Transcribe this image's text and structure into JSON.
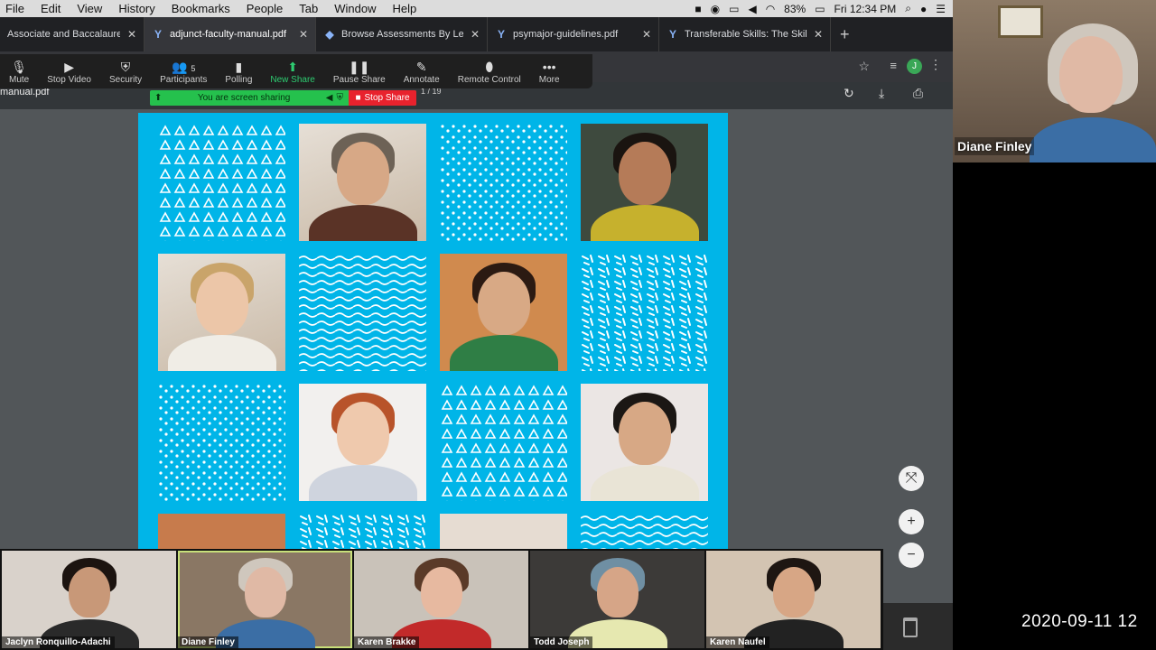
{
  "menubar": {
    "items": [
      "File",
      "Edit",
      "View",
      "History",
      "Bookmarks",
      "People",
      "Tab",
      "Window",
      "Help"
    ],
    "battery": "83%",
    "clock": "Fri 12:34 PM"
  },
  "tabs": [
    {
      "title": "Associate and Baccalaureate E",
      "active": false
    },
    {
      "title": "adjunct-faculty-manual.pdf",
      "active": true
    },
    {
      "title": "Browse Assessments By Learn",
      "active": false
    },
    {
      "title": "psymajor-guidelines.pdf",
      "active": false
    },
    {
      "title": "Transferable Skills: The Skillful",
      "active": false
    }
  ],
  "zoom_toolbar": {
    "mute": "Mute",
    "stop_video": "Stop Video",
    "security": "Security",
    "participants": "Participants",
    "participants_count": "5",
    "polling": "Polling",
    "new_share": "New Share",
    "pause_share": "Pause Share",
    "annotate": "Annotate",
    "remote_control": "Remote Control",
    "more": "More"
  },
  "share_banner": {
    "message": "You are screen sharing",
    "stop": "Stop Share"
  },
  "pdf": {
    "filename": "manual.pdf",
    "page_indicator": "1 / 19"
  },
  "profile_initial": "J",
  "gallery": [
    {
      "name": "Jaclyn Ronquillo-Adachi"
    },
    {
      "name": "Diane Finley"
    },
    {
      "name": "Karen Brakke"
    },
    {
      "name": "Todd Joseph"
    },
    {
      "name": "Karen Naufel"
    }
  ],
  "speaker": {
    "name": "Diane Finley"
  },
  "timestamp": "2020-09-11  12",
  "colors": {
    "page_bg": "#00b5e8",
    "share_green": "#25c14d",
    "stop_red": "#e8222d"
  }
}
